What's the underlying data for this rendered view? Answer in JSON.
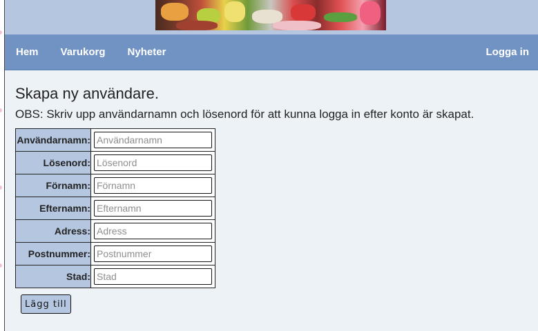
{
  "nav": {
    "items": [
      {
        "label": "Hem"
      },
      {
        "label": "Varukorg"
      },
      {
        "label": "Nyheter"
      }
    ],
    "login": "Logga in"
  },
  "banner": {
    "icon": "candy-banner-image"
  },
  "page": {
    "title": "Skapa ny användare.",
    "notice": "OBS: Skriv upp användarnamn och lösenord för att kunna logga in efter konto är skapat."
  },
  "form": {
    "fields": [
      {
        "label": "Användarnamn:",
        "placeholder": "Användarnamn",
        "value": ""
      },
      {
        "label": "Lösenord:",
        "placeholder": "Lösenord",
        "value": ""
      },
      {
        "label": "Förnamn:",
        "placeholder": "Förnamn",
        "value": ""
      },
      {
        "label": "Efternamn:",
        "placeholder": "Efternamn",
        "value": ""
      },
      {
        "label": "Adress:",
        "placeholder": "Adress",
        "value": ""
      },
      {
        "label": "Postnummer:",
        "placeholder": "Postnummer",
        "value": ""
      },
      {
        "label": "Stad:",
        "placeholder": "Stad",
        "value": ""
      }
    ],
    "submit_label": "Lägg till"
  },
  "colors": {
    "navbar": "#7093c3",
    "header": "#b4c6e0",
    "content_bg": "#edf2f7",
    "label_bg": "#b4c6e0"
  }
}
